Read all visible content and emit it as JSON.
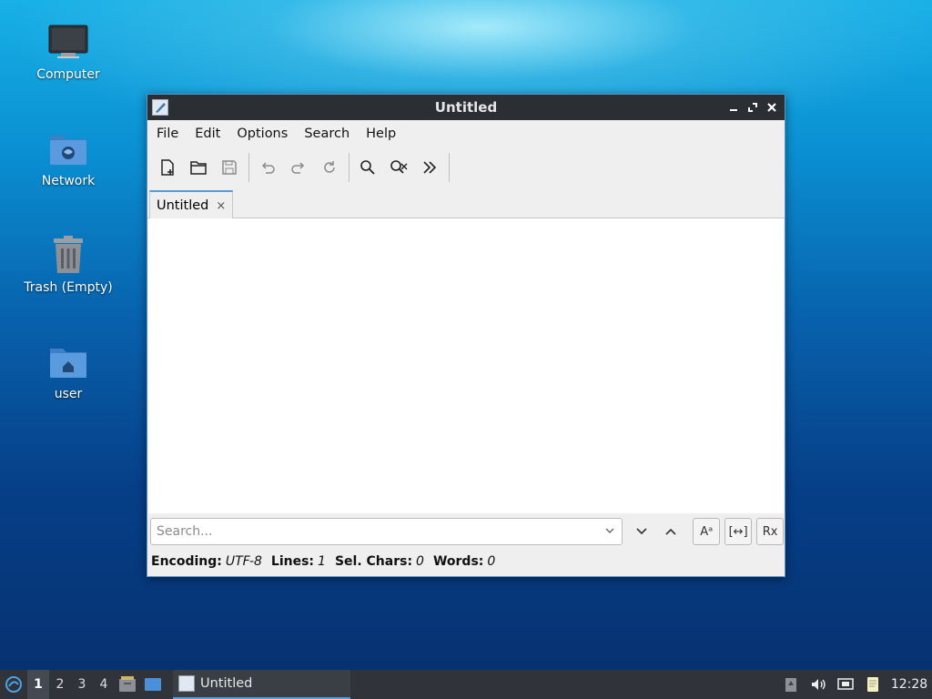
{
  "desktop": {
    "icons": [
      {
        "label": "Computer"
      },
      {
        "label": "Network"
      },
      {
        "label": "Trash (Empty)"
      },
      {
        "label": "user"
      }
    ]
  },
  "window": {
    "title": "Untitled",
    "menu": [
      "File",
      "Edit",
      "Options",
      "Search",
      "Help"
    ],
    "tab": {
      "label": "Untitled",
      "close": "×"
    },
    "search": {
      "placeholder": "Search...",
      "value": ""
    },
    "options": {
      "case": "Aᵃ",
      "whole": "[↔]",
      "regex": "Rx"
    },
    "status": {
      "encoding_label": "Encoding:",
      "encoding_value": "UTF-8",
      "lines_label": "Lines:",
      "lines_value": "1",
      "sel_label": "Sel. Chars:",
      "sel_value": "0",
      "words_label": "Words:",
      "words_value": "0"
    }
  },
  "taskbar": {
    "workspaces": [
      "1",
      "2",
      "3",
      "4"
    ],
    "active_workspace": "1",
    "task_label": "Untitled",
    "clock": "12:28"
  },
  "colors": {
    "accent": "#5b9bd5",
    "titlebar": "#2b2e33",
    "taskbar": "#30343a"
  }
}
